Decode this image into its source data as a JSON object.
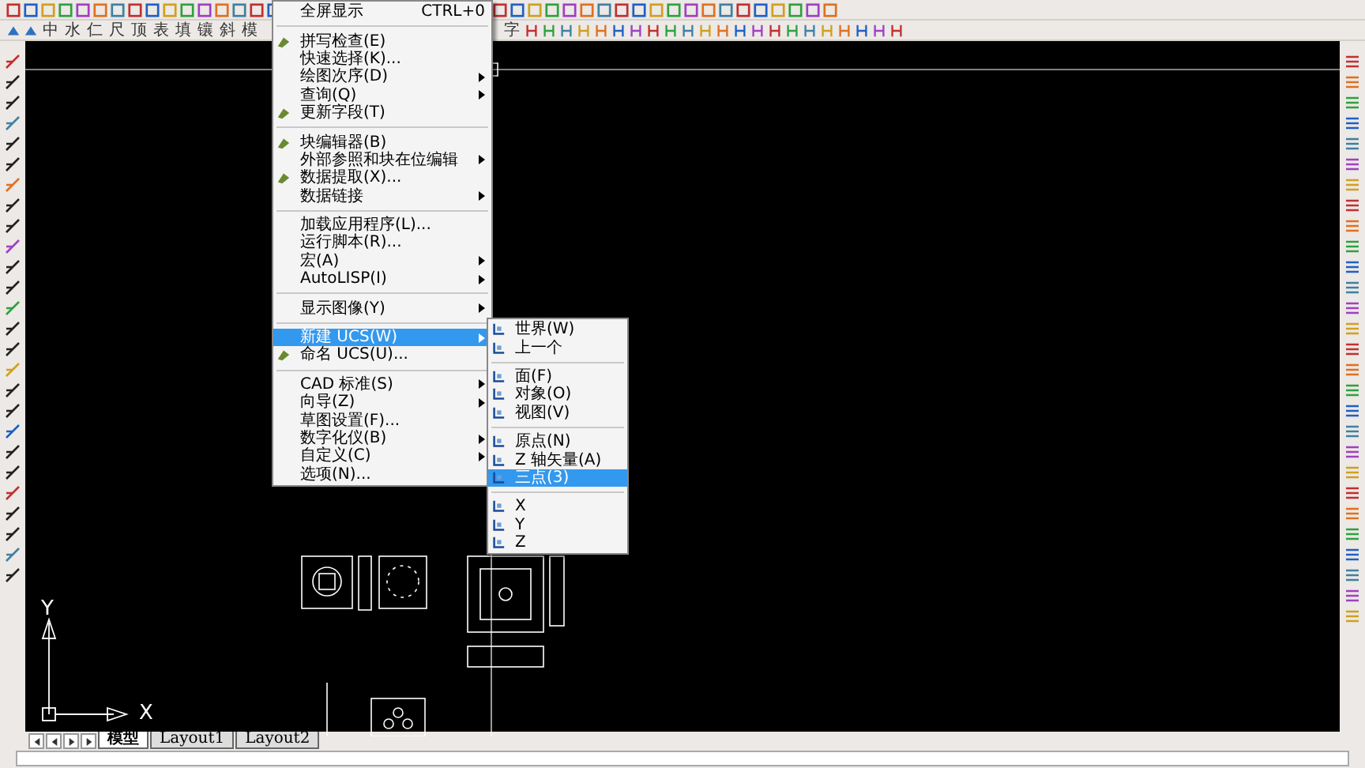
{
  "toolbar": {
    "text_buttons_left": [
      "中",
      "水",
      "仁",
      "尺",
      "顶",
      "表",
      "填",
      "镶",
      "斜",
      "模"
    ],
    "text_buttons_right": [
      "字"
    ]
  },
  "tools_menu": {
    "items": [
      {
        "kind": "item",
        "label": "全屏显示",
        "shortcut": "CTRL+0",
        "has_icon": false,
        "has_submenu": false,
        "selected": false
      },
      {
        "kind": "separator"
      },
      {
        "kind": "item",
        "label": "拼写检查(E)",
        "has_icon": true,
        "has_submenu": false,
        "selected": false
      },
      {
        "kind": "item",
        "label": "快速选择(K)...",
        "has_icon": false,
        "has_submenu": false,
        "selected": false
      },
      {
        "kind": "item",
        "label": "绘图次序(D)",
        "has_icon": false,
        "has_submenu": true,
        "selected": false
      },
      {
        "kind": "item",
        "label": "查询(Q)",
        "has_icon": false,
        "has_submenu": true,
        "selected": false
      },
      {
        "kind": "item",
        "label": "更新字段(T)",
        "has_icon": true,
        "has_submenu": false,
        "selected": false
      },
      {
        "kind": "separator"
      },
      {
        "kind": "item",
        "label": "块编辑器(B)",
        "has_icon": true,
        "has_submenu": false,
        "selected": false
      },
      {
        "kind": "item",
        "label": "外部参照和块在位编辑",
        "has_icon": false,
        "has_submenu": true,
        "selected": false
      },
      {
        "kind": "item",
        "label": "数据提取(X)...",
        "has_icon": true,
        "has_submenu": false,
        "selected": false
      },
      {
        "kind": "item",
        "label": "数据链接",
        "has_icon": false,
        "has_submenu": true,
        "selected": false
      },
      {
        "kind": "separator"
      },
      {
        "kind": "item",
        "label": "加载应用程序(L)...",
        "has_icon": false,
        "has_submenu": false,
        "selected": false
      },
      {
        "kind": "item",
        "label": "运行脚本(R)...",
        "has_icon": false,
        "has_submenu": false,
        "selected": false
      },
      {
        "kind": "item",
        "label": "宏(A)",
        "has_icon": false,
        "has_submenu": true,
        "selected": false
      },
      {
        "kind": "item",
        "label": "AutoLISP(I)",
        "has_icon": false,
        "has_submenu": true,
        "selected": false
      },
      {
        "kind": "separator"
      },
      {
        "kind": "item",
        "label": "显示图像(Y)",
        "has_icon": false,
        "has_submenu": true,
        "selected": false
      },
      {
        "kind": "separator"
      },
      {
        "kind": "item",
        "label": "新建 UCS(W)",
        "has_icon": false,
        "has_submenu": true,
        "selected": true
      },
      {
        "kind": "item",
        "label": "命名 UCS(U)...",
        "has_icon": true,
        "has_submenu": false,
        "selected": false
      },
      {
        "kind": "separator"
      },
      {
        "kind": "item",
        "label": "CAD 标准(S)",
        "has_icon": false,
        "has_submenu": true,
        "selected": false
      },
      {
        "kind": "item",
        "label": "向导(Z)",
        "has_icon": false,
        "has_submenu": true,
        "selected": false
      },
      {
        "kind": "item",
        "label": "草图设置(F)...",
        "has_icon": false,
        "has_submenu": false,
        "selected": false
      },
      {
        "kind": "item",
        "label": "数字化仪(B)",
        "has_icon": false,
        "has_submenu": true,
        "selected": false
      },
      {
        "kind": "item",
        "label": "自定义(C)",
        "has_icon": false,
        "has_submenu": true,
        "selected": false
      },
      {
        "kind": "item",
        "label": "选项(N)...",
        "has_icon": false,
        "has_submenu": false,
        "selected": false
      }
    ]
  },
  "ucs_submenu": {
    "items": [
      {
        "kind": "item",
        "label": "世界(W)",
        "selected": false
      },
      {
        "kind": "item",
        "label": "上一个",
        "selected": false
      },
      {
        "kind": "separator"
      },
      {
        "kind": "item",
        "label": "面(F)",
        "selected": false
      },
      {
        "kind": "item",
        "label": "对象(O)",
        "selected": false
      },
      {
        "kind": "item",
        "label": "视图(V)",
        "selected": false
      },
      {
        "kind": "separator"
      },
      {
        "kind": "item",
        "label": "原点(N)",
        "selected": false
      },
      {
        "kind": "item",
        "label": "Z 轴矢量(A)",
        "selected": false
      },
      {
        "kind": "item",
        "label": "三点(3)",
        "selected": true
      },
      {
        "kind": "separator"
      },
      {
        "kind": "item",
        "label": "X",
        "selected": false
      },
      {
        "kind": "item",
        "label": "Y",
        "selected": false
      },
      {
        "kind": "item",
        "label": "Z",
        "selected": false
      }
    ]
  },
  "canvas": {
    "ucs_x_label": "X",
    "ucs_y_label": "Y"
  },
  "layout_tabs": [
    {
      "label": "模型",
      "selected": true
    },
    {
      "label": "Layout1",
      "selected": false
    },
    {
      "label": "Layout2",
      "selected": false
    }
  ]
}
